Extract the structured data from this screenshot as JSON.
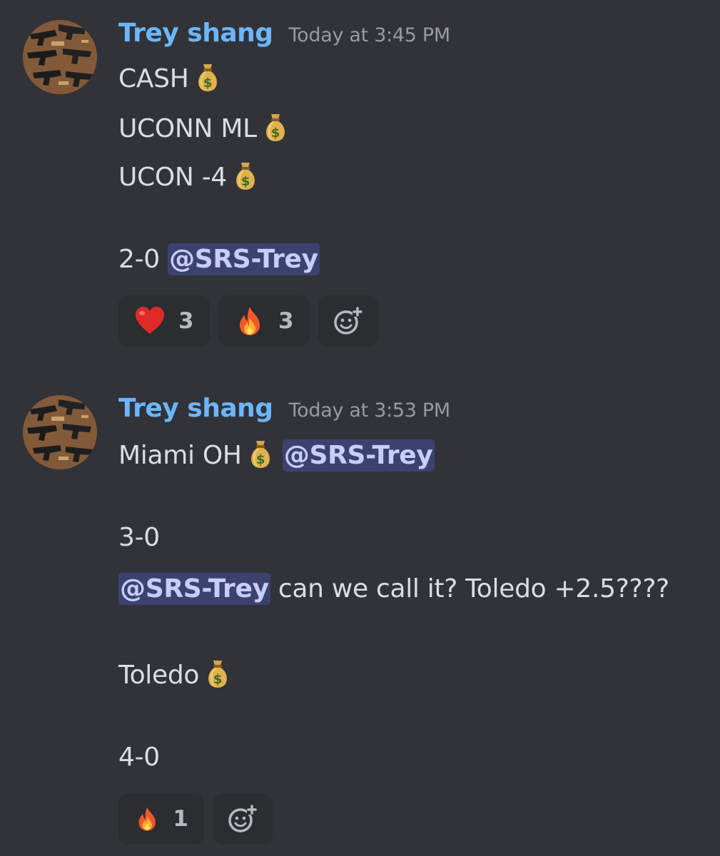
{
  "colors": {
    "background": "#313338",
    "username": "#6cb6ff",
    "timestamp": "#949ba4",
    "text": "#dbdee1",
    "mention_bg": "#3c4270",
    "mention_text": "#c9cdfb",
    "reaction_bg": "#2b2d31"
  },
  "messages": [
    {
      "username": "Trey shang",
      "timestamp": "Today at 3:45 PM",
      "avatar_icon": "avatar-image",
      "lines": {
        "l1": "CASH",
        "l2": "UCONN ML",
        "l3": "UCON -4",
        "l4_text": "2-0",
        "l4_mention": "@SRS-Trey"
      },
      "reactions": [
        {
          "emoji": "heart-emoji",
          "count": "3"
        },
        {
          "emoji": "fire-emoji",
          "count": "3"
        }
      ]
    },
    {
      "username": "Trey shang",
      "timestamp": "Today at 3:53 PM",
      "avatar_icon": "avatar-image",
      "lines": {
        "l1_text": "Miami OH",
        "l1_mention": "@SRS-Trey",
        "l2": "3-0",
        "l3_mention": "@SRS-Trey",
        "l3_text": " can we call it? Toledo +2.5????",
        "l4": "Toledo",
        "l5": "4-0"
      },
      "reactions": [
        {
          "emoji": "fire-emoji",
          "count": "1"
        }
      ]
    }
  ]
}
